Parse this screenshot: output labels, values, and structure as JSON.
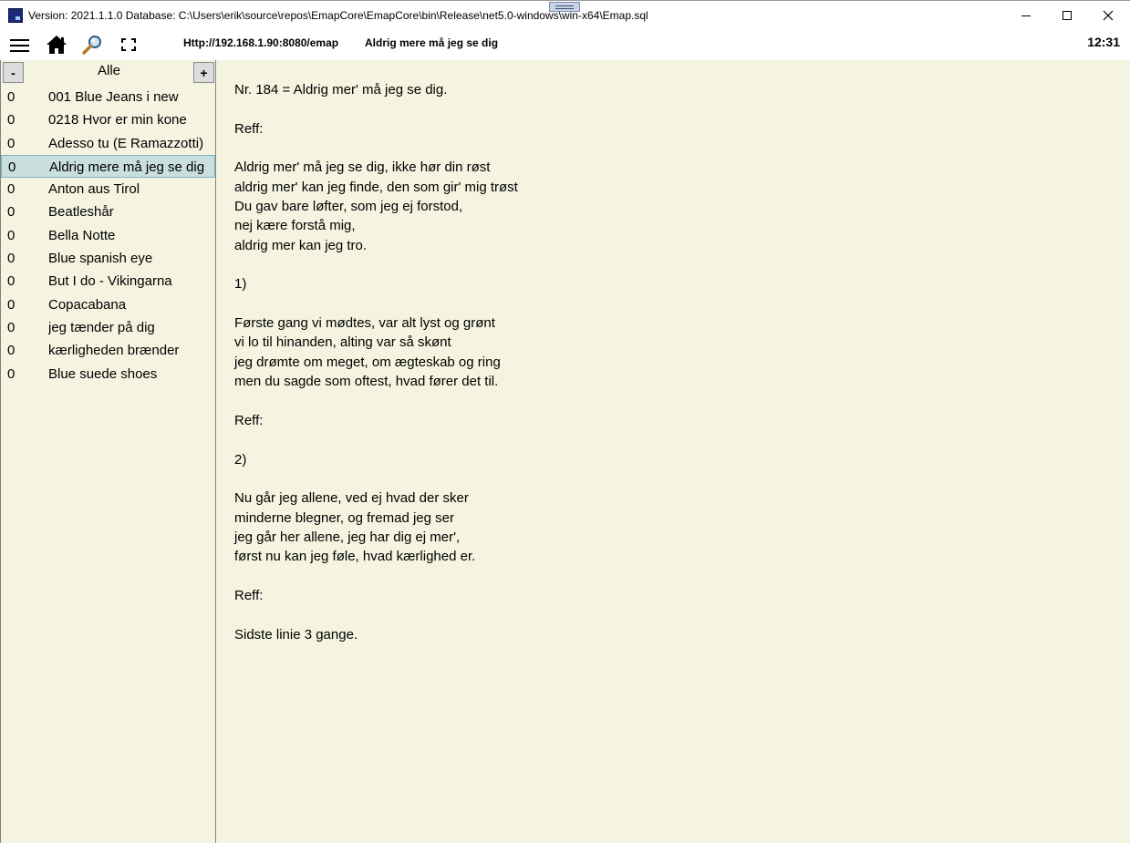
{
  "titlebar": {
    "title": "Version: 2021.1.1.0 Database: C:\\Users\\erik\\source\\repos\\EmapCore\\EmapCore\\bin\\Release\\net5.0-windows\\win-x64\\Emap.sql"
  },
  "toolbar": {
    "url": "Http://192.168.1.90:8080/emap",
    "current_song": "Aldrig mere må jeg se dig",
    "clock": "12:31"
  },
  "sidebar": {
    "minus_label": "-",
    "plus_label": "+",
    "category": "Alle",
    "items": [
      {
        "count": "0",
        "name": "001 Blue Jeans i new"
      },
      {
        "count": "0",
        "name": "0218 Hvor er min kone"
      },
      {
        "count": "0",
        "name": "Adesso tu (E Ramazzotti)"
      },
      {
        "count": "0",
        "name": "Aldrig mere må jeg se dig"
      },
      {
        "count": "0",
        "name": "Anton aus Tirol"
      },
      {
        "count": "0",
        "name": "Beatleshår"
      },
      {
        "count": "0",
        "name": "Bella Notte"
      },
      {
        "count": "0",
        "name": "Blue spanish eye"
      },
      {
        "count": "0",
        "name": "But I do - Vikingarna"
      },
      {
        "count": "0",
        "name": "Copacabana"
      },
      {
        "count": "0",
        "name": "jeg tænder på dig"
      },
      {
        "count": "0",
        "name": "kærligheden brænder"
      },
      {
        "count": "0",
        "name": "Blue suede shoes"
      }
    ]
  },
  "lyrics": {
    "lines": [
      "Nr. 184 = Aldrig mer' må jeg se dig.",
      "",
      "Reff:",
      "",
      "Aldrig mer' må jeg se dig, ikke hør din røst",
      "aldrig mer' kan jeg finde, den som gir' mig trøst",
      "Du gav bare løfter, som jeg ej forstod,",
      "nej kære forstå mig,",
      "aldrig mer kan jeg tro.",
      "",
      "1)",
      "",
      "Første gang vi mødtes, var alt lyst og grønt",
      "vi lo til hinanden, alting var så skønt",
      "jeg drømte om meget, om ægteskab og ring",
      "men du sagde som oftest, hvad fører det til.",
      "",
      "Reff:",
      "",
      "2)",
      "",
      "Nu går jeg allene, ved ej hvad der sker",
      "minderne blegner, og fremad jeg ser",
      "jeg går her allene, jeg har dig ej mer',",
      "først nu kan jeg føle, hvad kærlighed er.",
      "",
      "Reff:",
      "",
      "Sidste linie 3 gange."
    ]
  },
  "colors": {
    "panel_background": "#f5f4e1",
    "selection_background": "#c8dfdb",
    "selection_border": "#7db6c8"
  },
  "icons": {
    "app": "app-icon",
    "menu": "hamburger-menu-icon",
    "home": "home-icon",
    "search": "magnifier-icon",
    "fullscreen": "fullscreen-icon"
  },
  "selected_index": 3
}
